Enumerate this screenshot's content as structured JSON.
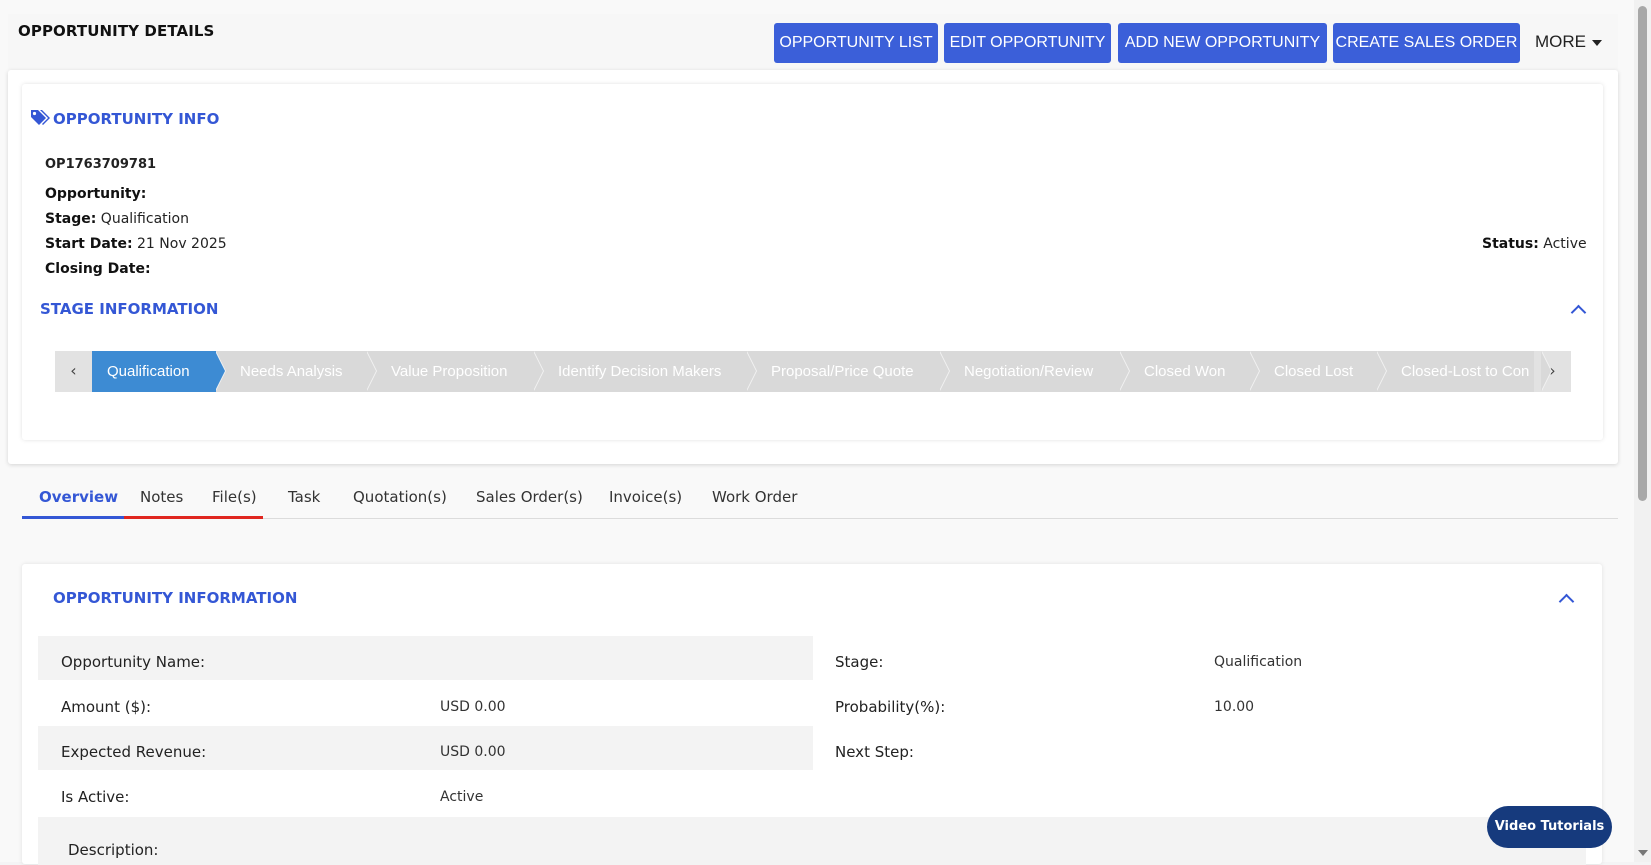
{
  "header": {
    "title": "OPPORTUNITY DETAILS",
    "buttons": {
      "list": "OPPORTUNITY LIST",
      "edit": "EDIT OPPORTUNITY",
      "add": "ADD NEW OPPORTUNITY",
      "create_so": "CREATE SALES ORDER"
    },
    "more": "MORE",
    "accent": "#3b5fd9"
  },
  "info": {
    "heading": "OPPORTUNITY INFO",
    "icon": "tags-icon",
    "id": "OP1763709781",
    "opportunity_label": "Opportunity:",
    "opportunity_value": "",
    "stage_label": "Stage:",
    "stage_value": "Qualification",
    "start_label": "Start Date:",
    "start_value": "21 Nov 2025",
    "closing_label": "Closing Date:",
    "closing_value": "",
    "status_label": "Status:",
    "status_value": "Active"
  },
  "stage_info": {
    "heading": "STAGE INFORMATION",
    "prev": "‹",
    "next": "›",
    "stages": [
      "Qualification",
      "Needs Analysis",
      "Value Proposition",
      "Identify Decision Makers",
      "Proposal/Price Quote",
      "Negotiation/Review",
      "Closed Won",
      "Closed Lost",
      "Closed-Lost to Con"
    ],
    "active_stage": "Qualification",
    "active_color": "#3d8bd3"
  },
  "tabs": [
    "Overview",
    "Notes",
    "File(s)",
    "Task",
    "Quotation(s)",
    "Sales Order(s)",
    "Invoice(s)",
    "Work Order"
  ],
  "overview": {
    "heading": "OPPORTUNITY INFORMATION",
    "opportunity_name_label": "Opportunity Name:",
    "opportunity_name_value": "",
    "amount_label": "Amount ($):",
    "amount_value": "USD 0.00",
    "expected_revenue_label": "Expected Revenue:",
    "expected_revenue_value": "USD 0.00",
    "is_active_label": "Is Active:",
    "is_active_value": "Active",
    "description_label": "Description:",
    "stage_label": "Stage:",
    "stage_value": "Qualification",
    "probability_label": "Probability(%):",
    "probability_value": "10.00",
    "next_step_label": "Next Step:",
    "next_step_value": ""
  },
  "video_tutorials": "Video Tutorials"
}
